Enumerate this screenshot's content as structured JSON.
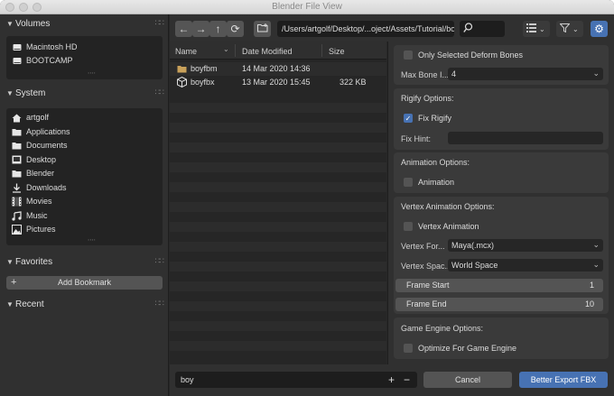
{
  "window": {
    "title": "Blender File View"
  },
  "sidebar": {
    "volumes": {
      "label": "Volumes",
      "items": [
        {
          "label": "Macintosh HD",
          "icon": "disk-icon"
        },
        {
          "label": "BOOTCAMP",
          "icon": "disk-icon"
        }
      ]
    },
    "system": {
      "label": "System",
      "items": [
        {
          "label": "artgolf",
          "icon": "home-icon"
        },
        {
          "label": "Applications",
          "icon": "folder-icon"
        },
        {
          "label": "Documents",
          "icon": "folder-icon"
        },
        {
          "label": "Desktop",
          "icon": "desktop-icon"
        },
        {
          "label": "Blender",
          "icon": "folder-icon"
        },
        {
          "label": "Downloads",
          "icon": "download-icon"
        },
        {
          "label": "Movies",
          "icon": "film-icon"
        },
        {
          "label": "Music",
          "icon": "music-icon"
        },
        {
          "label": "Pictures",
          "icon": "image-icon"
        }
      ]
    },
    "favorites": {
      "label": "Favorites",
      "add_bookmark": "Add Bookmark"
    },
    "recent": {
      "label": "Recent"
    }
  },
  "toolbar": {
    "path": "/Users/artgolf/Desktop/...oject/Assets/Tutorial/boy/",
    "search_value": ""
  },
  "filelist": {
    "columns": {
      "name": "Name",
      "date": "Date Modified",
      "size": "Size"
    },
    "rows": [
      {
        "name": "boyfbm",
        "date": "14 Mar 2020 14:36",
        "size": "",
        "icon": "folder-icon"
      },
      {
        "name": "boyfbx",
        "date": "13 Mar 2020 15:45",
        "size": "322 KB",
        "icon": "mesh-file-icon"
      }
    ]
  },
  "options": {
    "only_selected_deform": {
      "label": "Only Selected Deform Bones",
      "checked": false
    },
    "max_bone": {
      "label": "Max Bone I...",
      "value": "4"
    },
    "rigify": {
      "title": "Rigify Options:",
      "fix_rigify": {
        "label": "Fix Rigify",
        "checked": true
      },
      "fix_hint": {
        "label": "Fix Hint:",
        "value": ""
      }
    },
    "animation": {
      "title": "Animation Options:",
      "animation": {
        "label": "Animation",
        "checked": false
      }
    },
    "vertex": {
      "title": "Vertex Animation Options:",
      "vertex_animation": {
        "label": "Vertex Animation",
        "checked": false
      },
      "vertex_format": {
        "label": "Vertex For...",
        "value": "Maya(.mcx)"
      },
      "vertex_space": {
        "label": "Vertex Spac...",
        "value": "World Space"
      },
      "frame_start": {
        "label": "Frame Start",
        "value": "1"
      },
      "frame_end": {
        "label": "Frame End",
        "value": "10"
      }
    },
    "game_engine": {
      "title": "Game Engine Options:",
      "optimize": {
        "label": "Optimize For Game Engine",
        "checked": false
      }
    }
  },
  "footer": {
    "filename": "boy",
    "cancel": "Cancel",
    "export": "Better Export FBX"
  },
  "colors": {
    "accent": "#4772b3",
    "background": "#282828"
  }
}
